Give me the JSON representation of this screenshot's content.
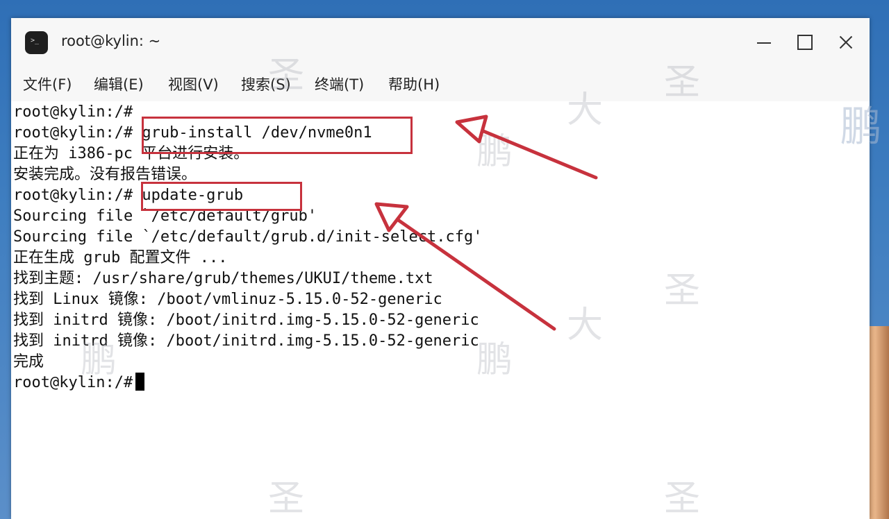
{
  "window": {
    "title": "root@kylin: ~"
  },
  "menu": [
    {
      "label": "文件(F)"
    },
    {
      "label": "编辑(E)"
    },
    {
      "label": "视图(V)"
    },
    {
      "label": "搜索(S)"
    },
    {
      "label": "终端(T)"
    },
    {
      "label": "帮助(H)"
    }
  ],
  "terminal": {
    "lines": [
      "root@kylin:/#",
      "root@kylin:/# grub-install /dev/nvme0n1",
      "正在为 i386-pc 平台进行安装。",
      "安装完成。没有报告错误。",
      "root@kylin:/# update-grub",
      "Sourcing file `/etc/default/grub'",
      "Sourcing file `/etc/default/grub.d/init-select.cfg'",
      "正在生成 grub 配置文件 ...",
      "找到主题: /usr/share/grub/themes/UKUI/theme.txt",
      "找到 Linux 镜像: /boot/vmlinuz-5.15.0-52-generic",
      "找到 initrd 镜像: /boot/initrd.img-5.15.0-52-generic",
      "找到 initrd 镜像: /boot/initrd.img-5.15.0-52-generic",
      "完成"
    ],
    "prompt": "root@kylin:/#"
  },
  "colors": {
    "annotation": "#c7323d",
    "background_desktop": "#3f7ec0"
  },
  "icons": [
    "terminal-app-icon",
    "minimize-icon",
    "maximize-icon",
    "close-icon"
  ]
}
